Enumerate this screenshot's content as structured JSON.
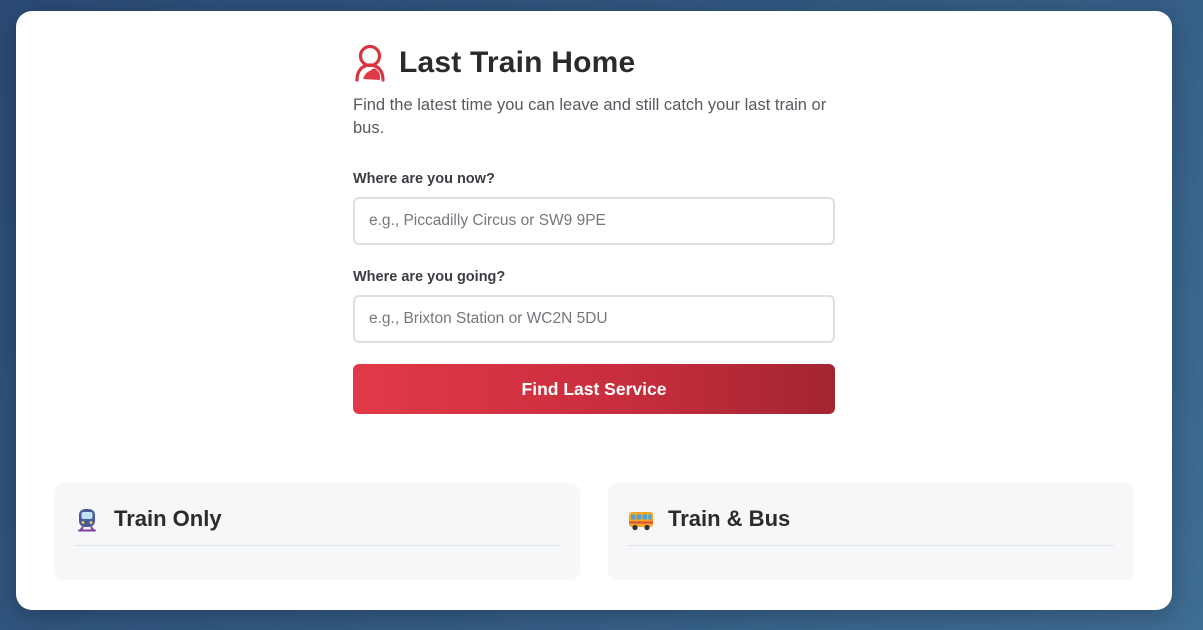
{
  "app": {
    "title": "Last Train Home",
    "subtitle": "Find the latest time you can leave and still catch your last train or bus.",
    "brand_icon": "person-marker-icon",
    "accent_color": "#d9343f"
  },
  "form": {
    "from_label": "Where are you now?",
    "from_placeholder": "e.g., Piccadilly Circus or SW9 9PE",
    "from_value": "",
    "to_label": "Where are you going?",
    "to_placeholder": "e.g., Brixton Station or WC2N 5DU",
    "to_value": "",
    "submit_label": "Find Last Service"
  },
  "panels": [
    {
      "title": "Train Only",
      "icon": "metro-train-icon"
    },
    {
      "title": "Train & Bus",
      "icon": "bus-icon"
    }
  ]
}
